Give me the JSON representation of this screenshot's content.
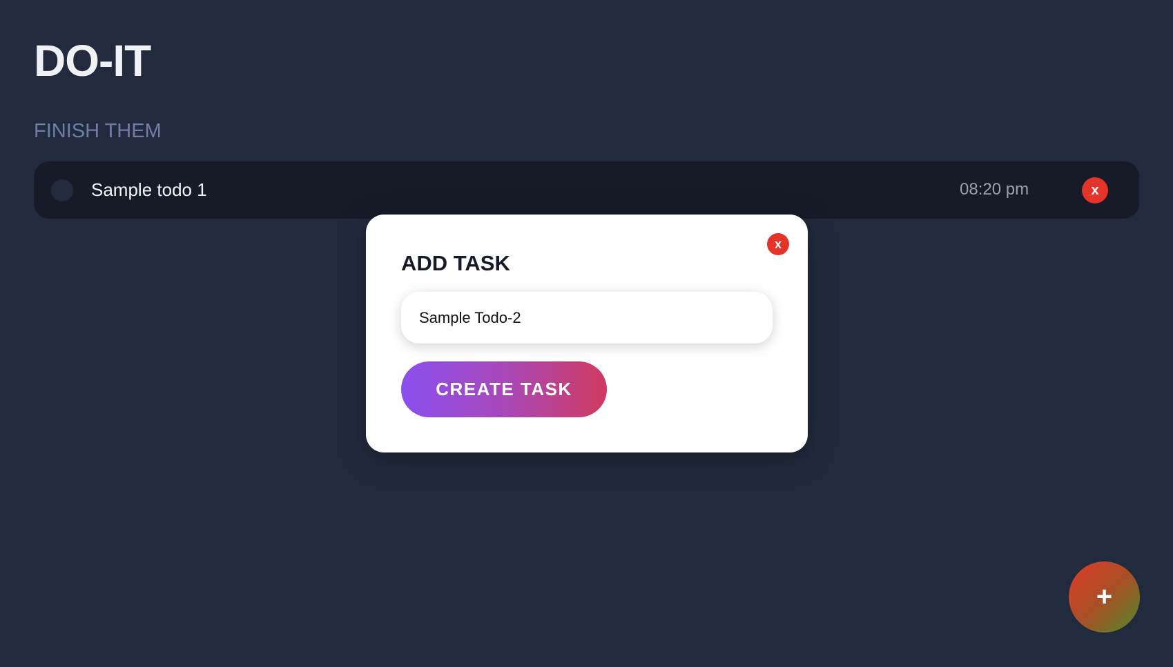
{
  "app": {
    "title": "DO-IT",
    "section_label": "FINISH THEM"
  },
  "todos": [
    {
      "text": "Sample todo 1",
      "time": "08:20 pm",
      "delete_label": "x",
      "completed": false
    }
  ],
  "modal": {
    "title": "ADD TASK",
    "close_label": "x",
    "input_value": "Sample Todo-2",
    "input_placeholder": "",
    "create_label": "CREATE TASK"
  },
  "fab": {
    "label": "+"
  },
  "colors": {
    "background": "#222b3d",
    "row": "#161b27",
    "danger": "#e4342a",
    "accent_gradient_start": "#8a4fef",
    "accent_gradient_end": "#cf3a5f"
  },
  "icons": {
    "todo_check": "circle-checkbox-icon",
    "delete": "close-icon",
    "fab": "plus-icon"
  }
}
